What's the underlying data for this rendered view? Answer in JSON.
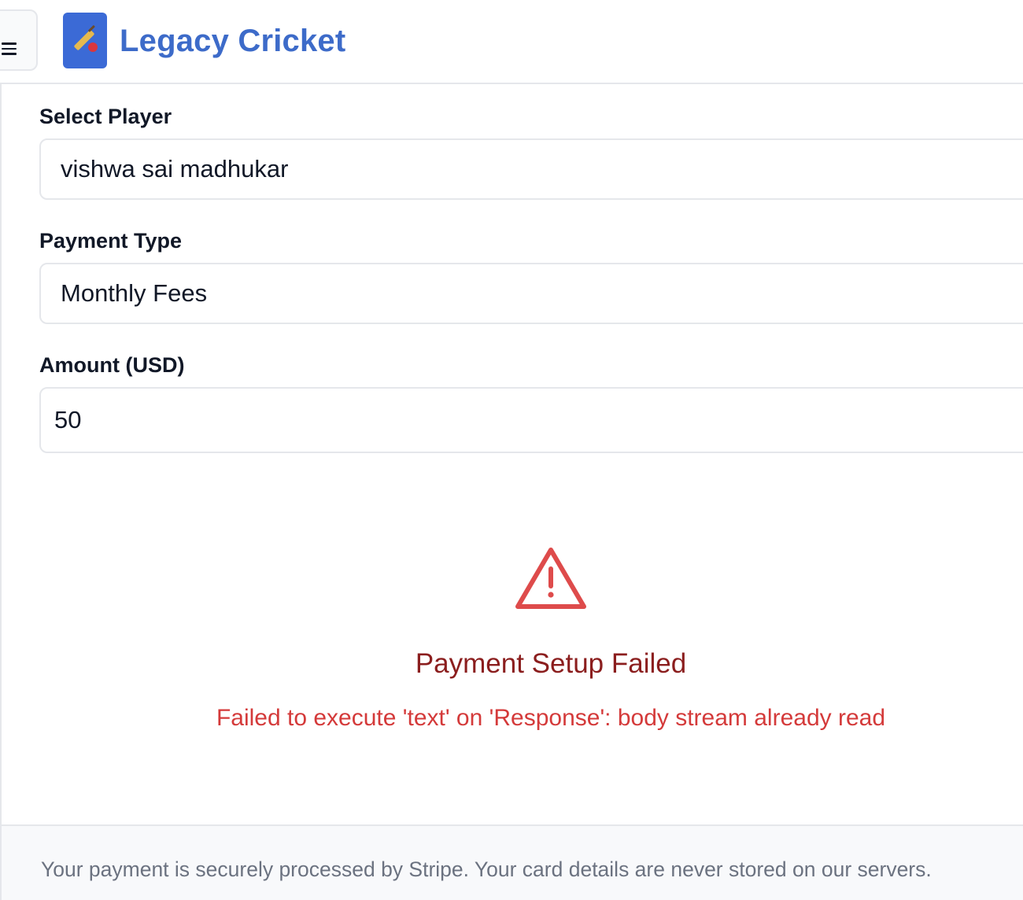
{
  "header": {
    "menu_icon": "hamburger-menu-icon",
    "logo_icon": "cricket-bat-ball-icon",
    "brand_title": "Legacy Cricket"
  },
  "form": {
    "player": {
      "label": "Select Player",
      "value": "vishwa sai madhukar"
    },
    "payment_type": {
      "label": "Payment Type",
      "value": "Monthly Fees"
    },
    "amount": {
      "label": "Amount (USD)",
      "value": "50"
    }
  },
  "error": {
    "icon": "warning-triangle-icon",
    "title": "Payment Setup Failed",
    "message": "Failed to execute 'text' on 'Response': body stream already read"
  },
  "footer": {
    "note": "Your payment is securely processed by Stripe. Your card details are never stored on our servers."
  },
  "colors": {
    "brand": "#3d6bc9",
    "logo_bg": "#3b6ad6",
    "error_title": "#8b1e1e",
    "error_text": "#d43a3a",
    "error_icon": "#de4b4b",
    "border": "#e5e7eb",
    "footer_text": "#6b7280"
  }
}
